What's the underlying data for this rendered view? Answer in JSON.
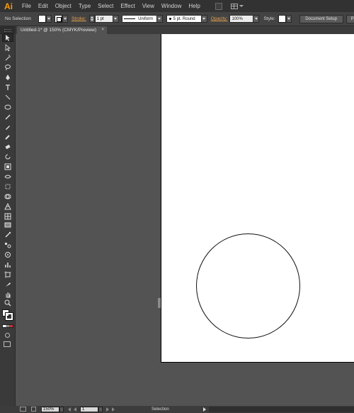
{
  "menubar": {
    "logo": "Ai",
    "items": [
      "File",
      "Edit",
      "Object",
      "Type",
      "Select",
      "Effect",
      "View",
      "Window",
      "Help"
    ]
  },
  "controlbar": {
    "selection_label": "No Selection",
    "stroke_label": "Stroke:",
    "stroke_weight": "1 pt",
    "profile_label": "Uniform",
    "brush_label": "5 pt. Round",
    "opacity_label": "Opacity:",
    "opacity_value": "100%",
    "style_label": "Style:",
    "document_setup_label": "Document Setup",
    "preferences_label": "Prefer"
  },
  "tabbar": {
    "doc_tab_label": "Untitled-1* @ 150% (CMYK/Preview)",
    "close_glyph": "×"
  },
  "statusbar": {
    "zoom_value": "150%",
    "artboard_value": "1",
    "status_text": "Selection"
  },
  "tools": [
    "selection-tool-icon",
    "direct-selection-tool-icon",
    "magic-wand-tool-icon",
    "lasso-tool-icon",
    "pen-tool-icon",
    "type-tool-icon",
    "line-segment-tool-icon",
    "ellipse-tool-icon",
    "paintbrush-tool-icon",
    "pencil-tool-icon",
    "blob-brush-tool-icon",
    "eraser-tool-icon",
    "rotate-tool-icon",
    "scale-tool-icon",
    "width-tool-icon",
    "free-transform-tool-icon",
    "shape-builder-tool-icon",
    "perspective-grid-tool-icon",
    "mesh-tool-icon",
    "gradient-tool-icon",
    "eyedropper-tool-icon",
    "blend-tool-icon",
    "symbol-sprayer-tool-icon",
    "column-graph-tool-icon",
    "artboard-tool-icon",
    "slice-tool-icon",
    "hand-tool-icon",
    "zoom-tool-icon"
  ],
  "colors": {
    "menubar_bg": "#323232",
    "controlbar_bg": "#434343",
    "canvas_bg": "#535353",
    "artboard": "#ffffff",
    "accent_orange": "#ff9a00"
  }
}
